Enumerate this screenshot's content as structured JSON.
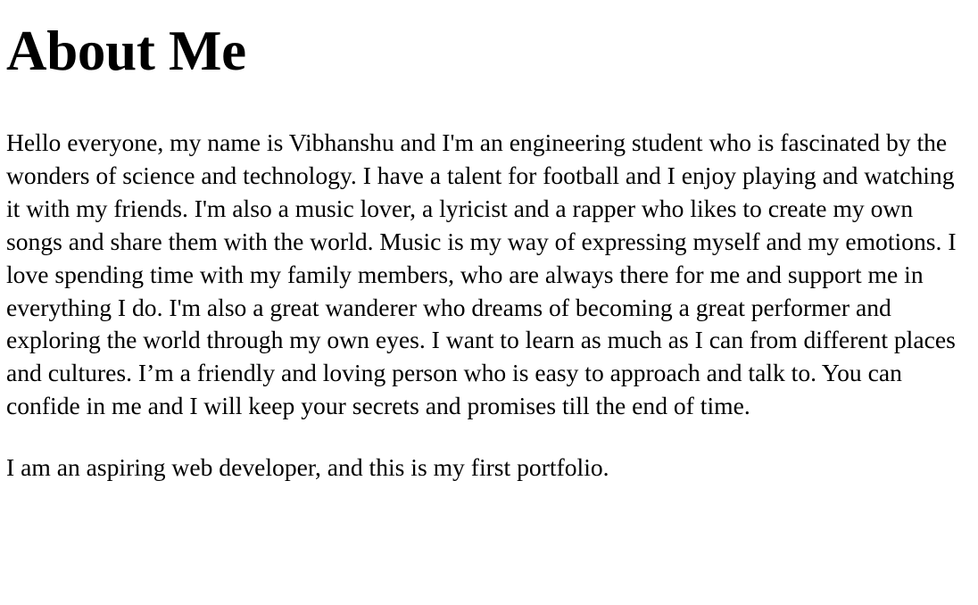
{
  "page": {
    "title": "About Me",
    "paragraphs": [
      "Hello everyone, my name is Vibhanshu and I'm an engineering student who is fascinated by the wonders of science and technology. I have a talent for football and I enjoy playing and watching it with my friends. I'm also a music lover, a lyricist and a rapper who likes to create my own songs and share them with the world. Music is my way of expressing myself and my emotions. I love spending time with my family members, who are always there for me and support me in everything I do. I'm also a great wanderer who dreams of becoming a great performer and exploring the world through my own eyes. I want to learn as much as I can from different places and cultures. I’m a friendly and loving person who is easy to approach and talk to. You can confide in me and I will keep your secrets and promises till the end of time.",
      "I am an aspiring web developer, and this is my first portfolio."
    ]
  },
  "colors": {
    "background": "#ffffff",
    "text": "#000000"
  }
}
